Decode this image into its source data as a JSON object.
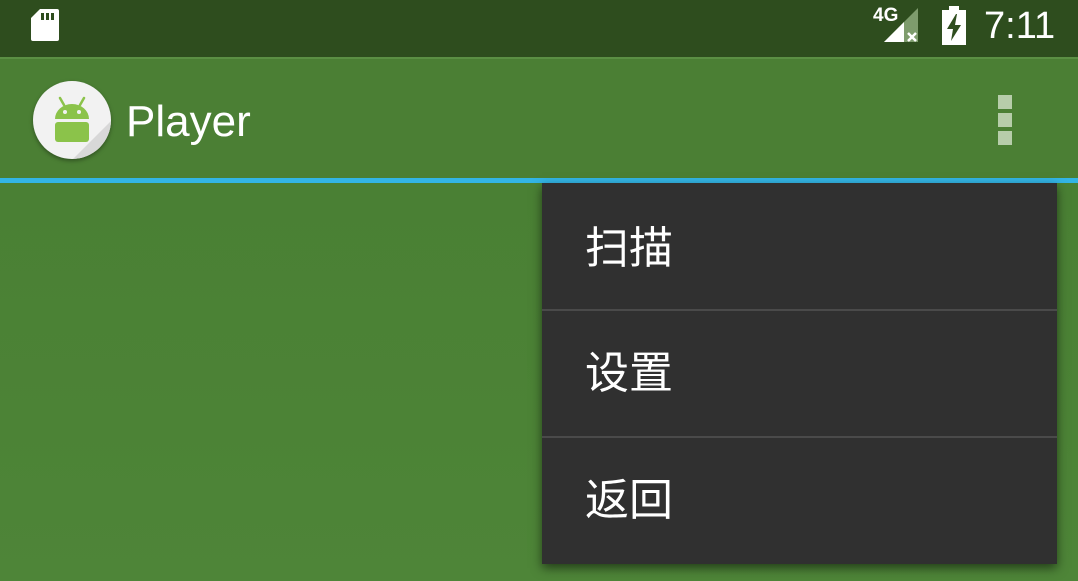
{
  "status_bar": {
    "network_type": "4G",
    "time": "7:11",
    "icons": [
      "sd-card-icon",
      "signal-no-data-icon",
      "battery-charging-icon"
    ]
  },
  "app_bar": {
    "title": "Player",
    "app_icon": "android-icon",
    "overflow_icon": "overflow-menu-icon"
  },
  "menu": {
    "items": [
      {
        "label": "扫描"
      },
      {
        "label": "设置"
      },
      {
        "label": "返回"
      }
    ]
  },
  "colors": {
    "status_bar": "#2e4d1e",
    "app_bar": "#4b7f34",
    "tab_indicator": "#33b5e5",
    "menu_background": "#303030"
  }
}
